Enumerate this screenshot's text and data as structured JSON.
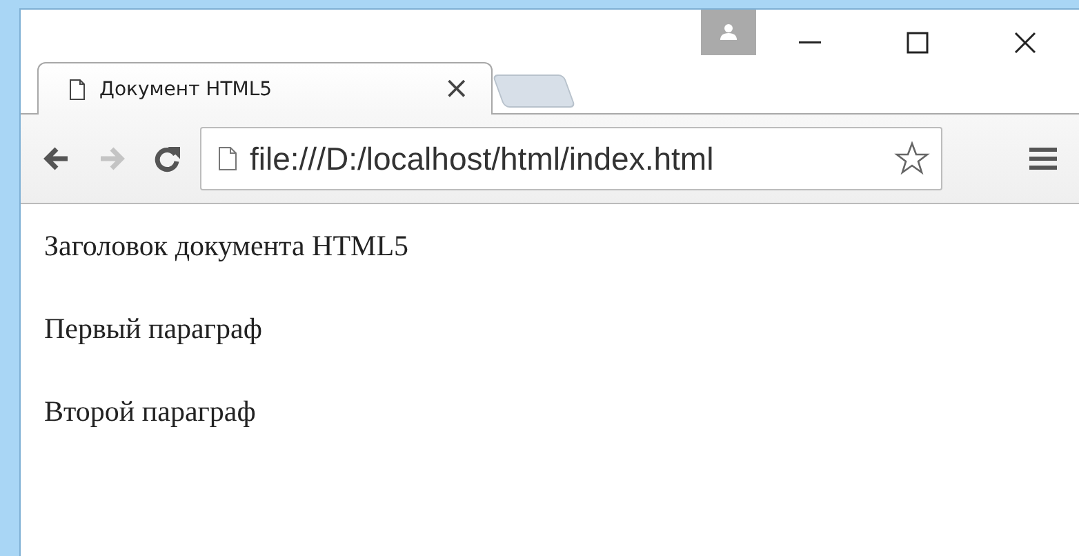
{
  "tabs": [
    {
      "title": "Документ HTML5",
      "selected": true,
      "close": "×"
    }
  ],
  "nav_buttons": [
    {
      "kind": "back",
      "disabled": false
    },
    {
      "kind": "forward",
      "disabled": true
    },
    {
      "kind": "reload",
      "disabled": false
    }
  ],
  "address_bar": {
    "value": "file:///D:/localhost/html/index.html"
  },
  "page": {
    "paragraphs": [
      "Заголовок документа HTML5",
      "Первый параграф",
      "Второй параграф"
    ]
  }
}
